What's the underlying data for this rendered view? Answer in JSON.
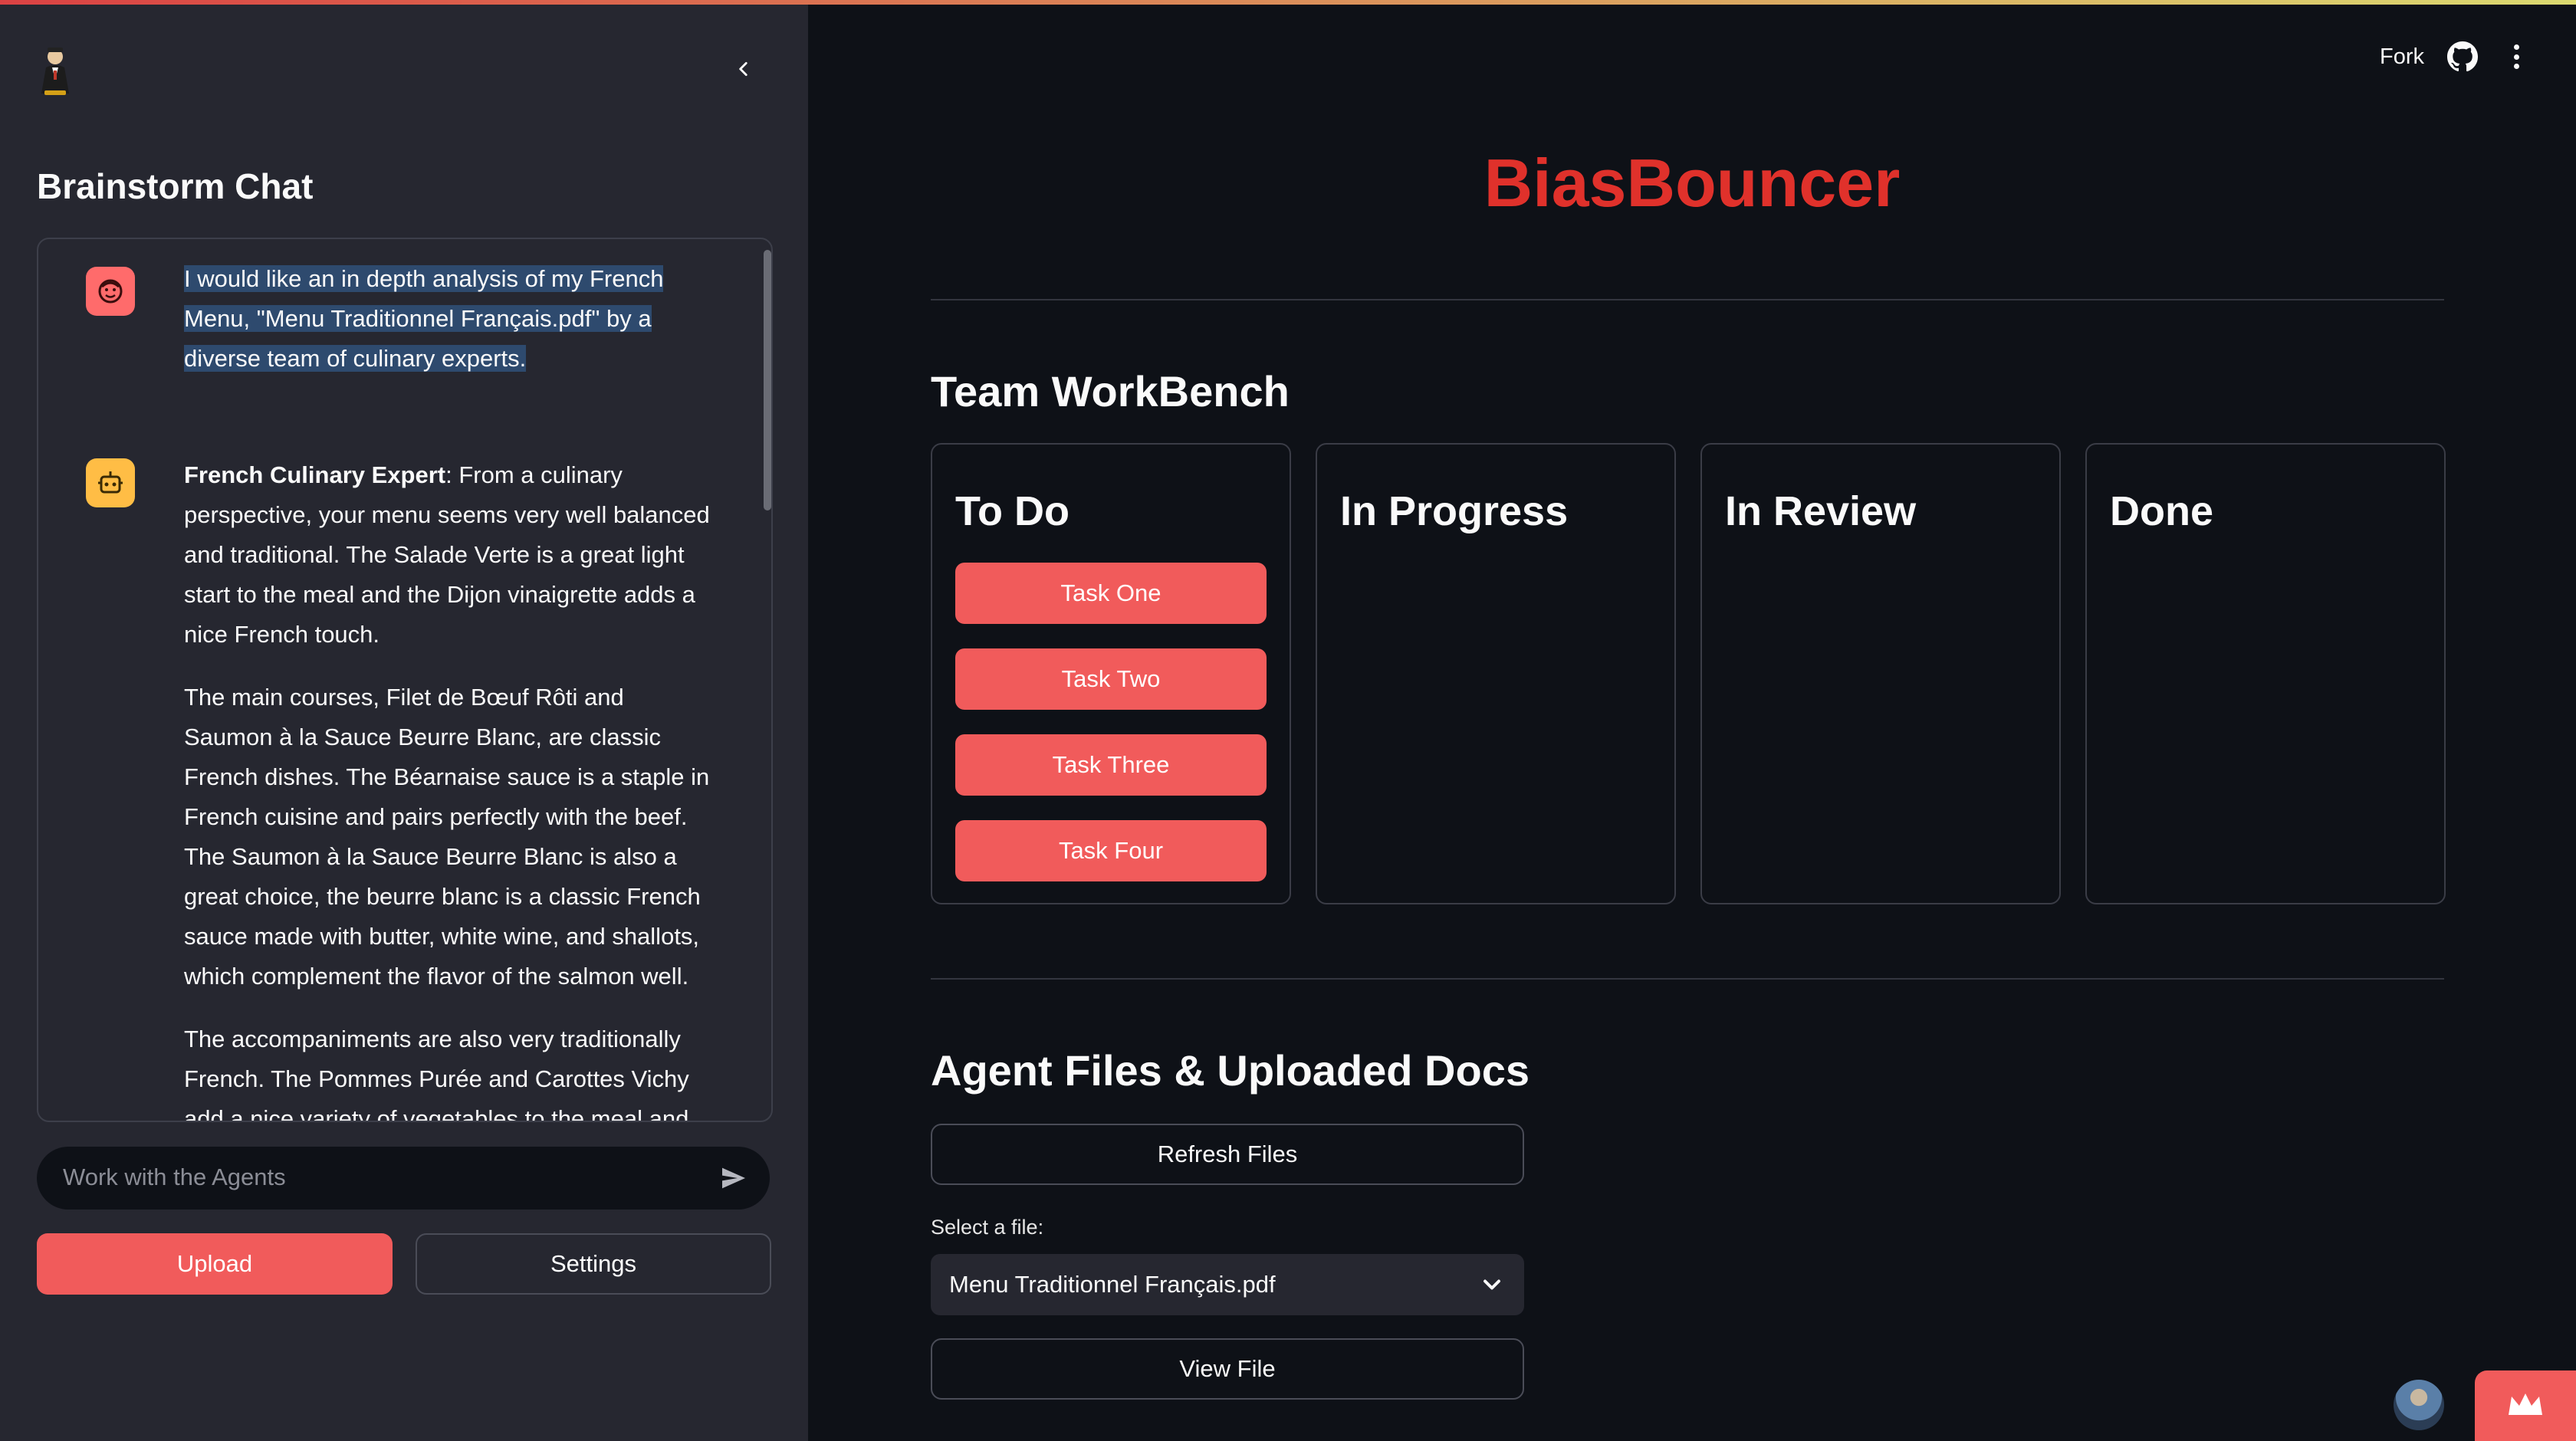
{
  "sidebar": {
    "title": "Brainstorm Chat",
    "messages": [
      {
        "role": "user",
        "text": "I would like an in depth analysis of my French Menu, \"Menu Traditionnel Français.pdf\" by a diverse team of culinary experts."
      },
      {
        "role": "assistant",
        "speaker": "French Culinary Expert",
        "paragraphs": [
          ": From a culinary perspective, your menu seems very well balanced and traditional. The Salade Verte is a great light start to the meal and the Dijon vinaigrette adds a nice French touch.",
          "The main courses, Filet de Bœuf Rôti and Saumon à la Sauce Beurre Blanc, are classic French dishes. The Béarnaise sauce is a staple in French cuisine and pairs perfectly with the beef. The Saumon à la Sauce Beurre Blanc is also a great choice, the beurre blanc is a classic French sauce made with butter, white wine, and shallots, which complement the flavor of the salmon well.",
          "The accompaniments are also very traditionally French. The Pommes Purée and Carottes Vichy add a nice variety of vegetables to the meal and the use of butter in both these dishes is very French. The Asperges Rôties is a nice addition, adding some lightness to the meal."
        ]
      }
    ],
    "input_placeholder": "Work with the Agents",
    "upload_label": "Upload",
    "settings_label": "Settings"
  },
  "header": {
    "fork_label": "Fork",
    "icons": [
      "github-icon",
      "more-vert-icon"
    ]
  },
  "main": {
    "app_title": "BiasBouncer",
    "workbench_title": "Team WorkBench",
    "columns": [
      {
        "title": "To Do",
        "tasks": [
          "Task One",
          "Task Two",
          "Task Three",
          "Task Four"
        ]
      },
      {
        "title": "In Progress",
        "tasks": []
      },
      {
        "title": "In Review",
        "tasks": []
      },
      {
        "title": "Done",
        "tasks": []
      }
    ],
    "files_title": "Agent Files & Uploaded Docs",
    "refresh_label": "Refresh Files",
    "select_label": "Select a file:",
    "selected_file": "Menu Traditionnel Français.pdf",
    "view_label": "View File"
  },
  "colors": {
    "accent": "#f15b5b",
    "title_red": "#e0312b",
    "background": "#0e1117",
    "sidebar_bg": "#262730",
    "user_avatar": "#ff6b6b",
    "bot_avatar": "#ffbd45"
  }
}
